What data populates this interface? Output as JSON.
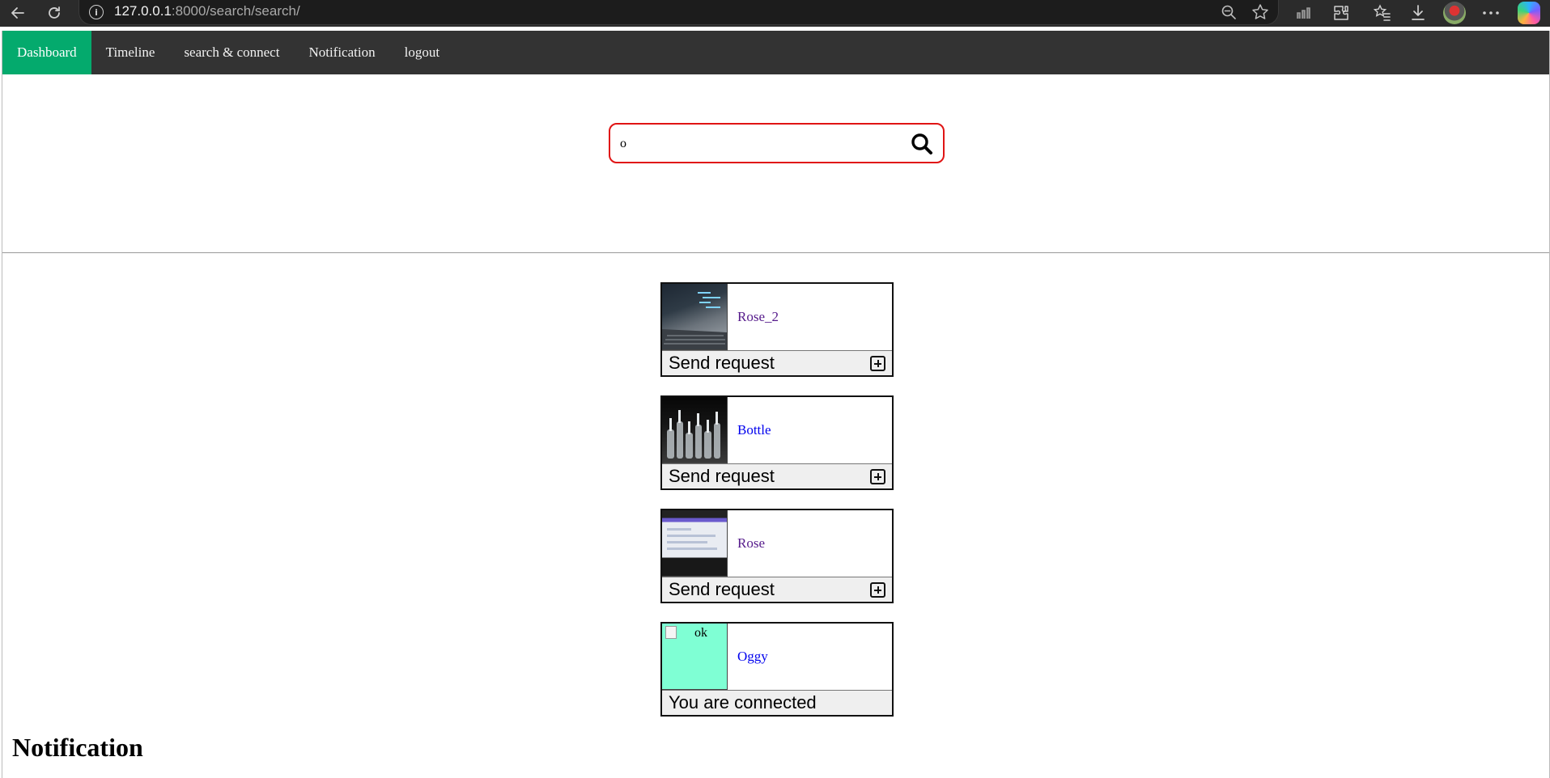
{
  "browser": {
    "url_host": "127.0.0.1",
    "url_rest": ":8000/search/search/",
    "icons": [
      "back-icon",
      "reload-icon",
      "info-icon",
      "zoom-out-icon",
      "favorite-star-icon",
      "performance-icon",
      "extensions-icon",
      "favorites-icon",
      "downloads-icon",
      "profile-avatar",
      "more-icon",
      "copilot-icon"
    ]
  },
  "nav": {
    "items": [
      {
        "label": "Dashboard",
        "active": true
      },
      {
        "label": "Timeline"
      },
      {
        "label": "search & connect"
      },
      {
        "label": "Notification"
      },
      {
        "label": "logout"
      }
    ]
  },
  "search": {
    "value": "o",
    "icon": "search-icon",
    "border_color": "#e01414"
  },
  "results": [
    {
      "name": "Rose_2",
      "action": "Send request",
      "link_state": "visited"
    },
    {
      "name": "Bottle",
      "action": "Send request",
      "link_state": "unvisited"
    },
    {
      "name": "Rose",
      "action": "Send request",
      "link_state": "visited"
    },
    {
      "name": "Oggy",
      "action": "You are connected",
      "image_alt": "ok",
      "link_state": "unvisited"
    }
  ],
  "colors": {
    "nav_bg": "#333333",
    "nav_active": "#04aa6d",
    "broken_thumb_bg": "#7fffd4"
  },
  "notification_heading": "Notification"
}
